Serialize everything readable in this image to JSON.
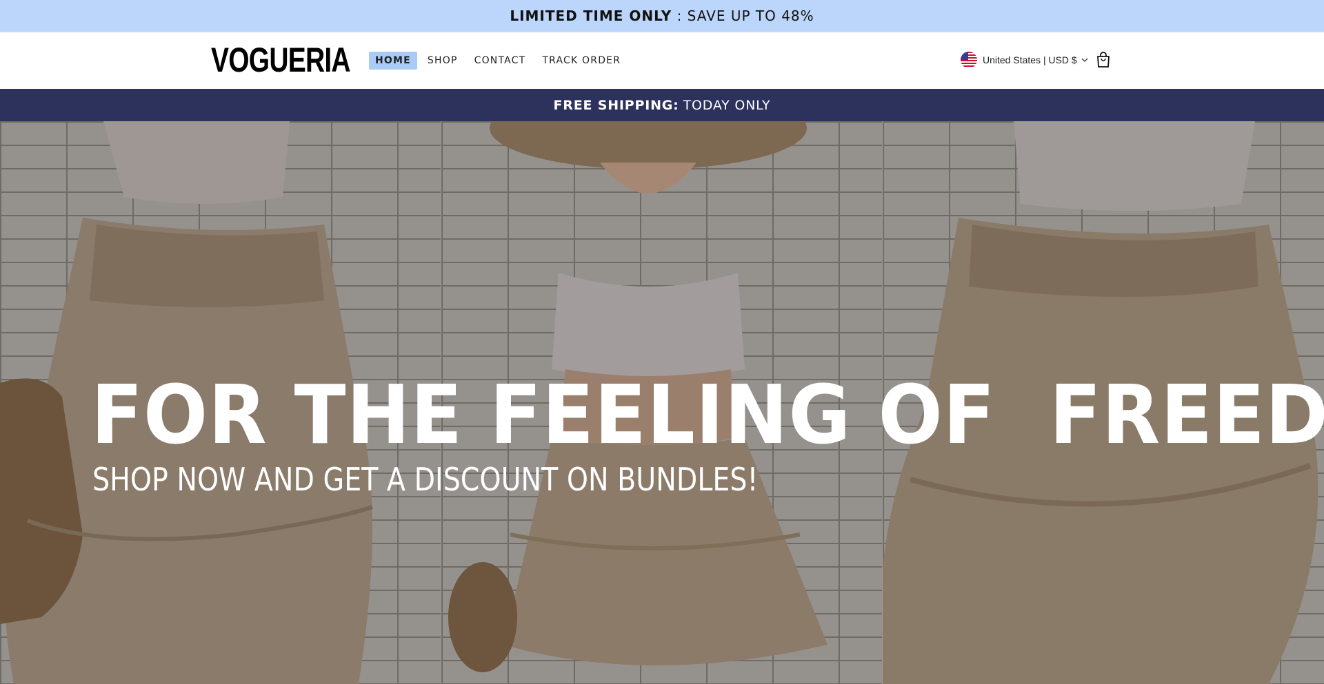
{
  "announcement": {
    "bold": "LIMITED TIME ONLY",
    "rest": " : SAVE UP TO 48%",
    "bg": "#bcd6fb"
  },
  "header": {
    "logo": "VOGUERIA",
    "nav": [
      {
        "label": "HOME",
        "active": true
      },
      {
        "label": "SHOP",
        "active": false
      },
      {
        "label": "CONTACT",
        "active": false
      },
      {
        "label": "TRACK ORDER",
        "active": false
      }
    ],
    "locale": "United States | USD $",
    "flag_icon": "us-flag-icon",
    "cart_icon": "shopping-bag-icon"
  },
  "shipping_bar": {
    "bold": "FREE SHIPPING:",
    "rest": "TODAY ONLY",
    "bg": "#2d325d"
  },
  "hero": {
    "headline": "FOR THE FEELING OF  FREEDOM",
    "subline": "SHOP NOW AND GET A DISCOUNT ON BUNDLES!",
    "panels": 3
  }
}
